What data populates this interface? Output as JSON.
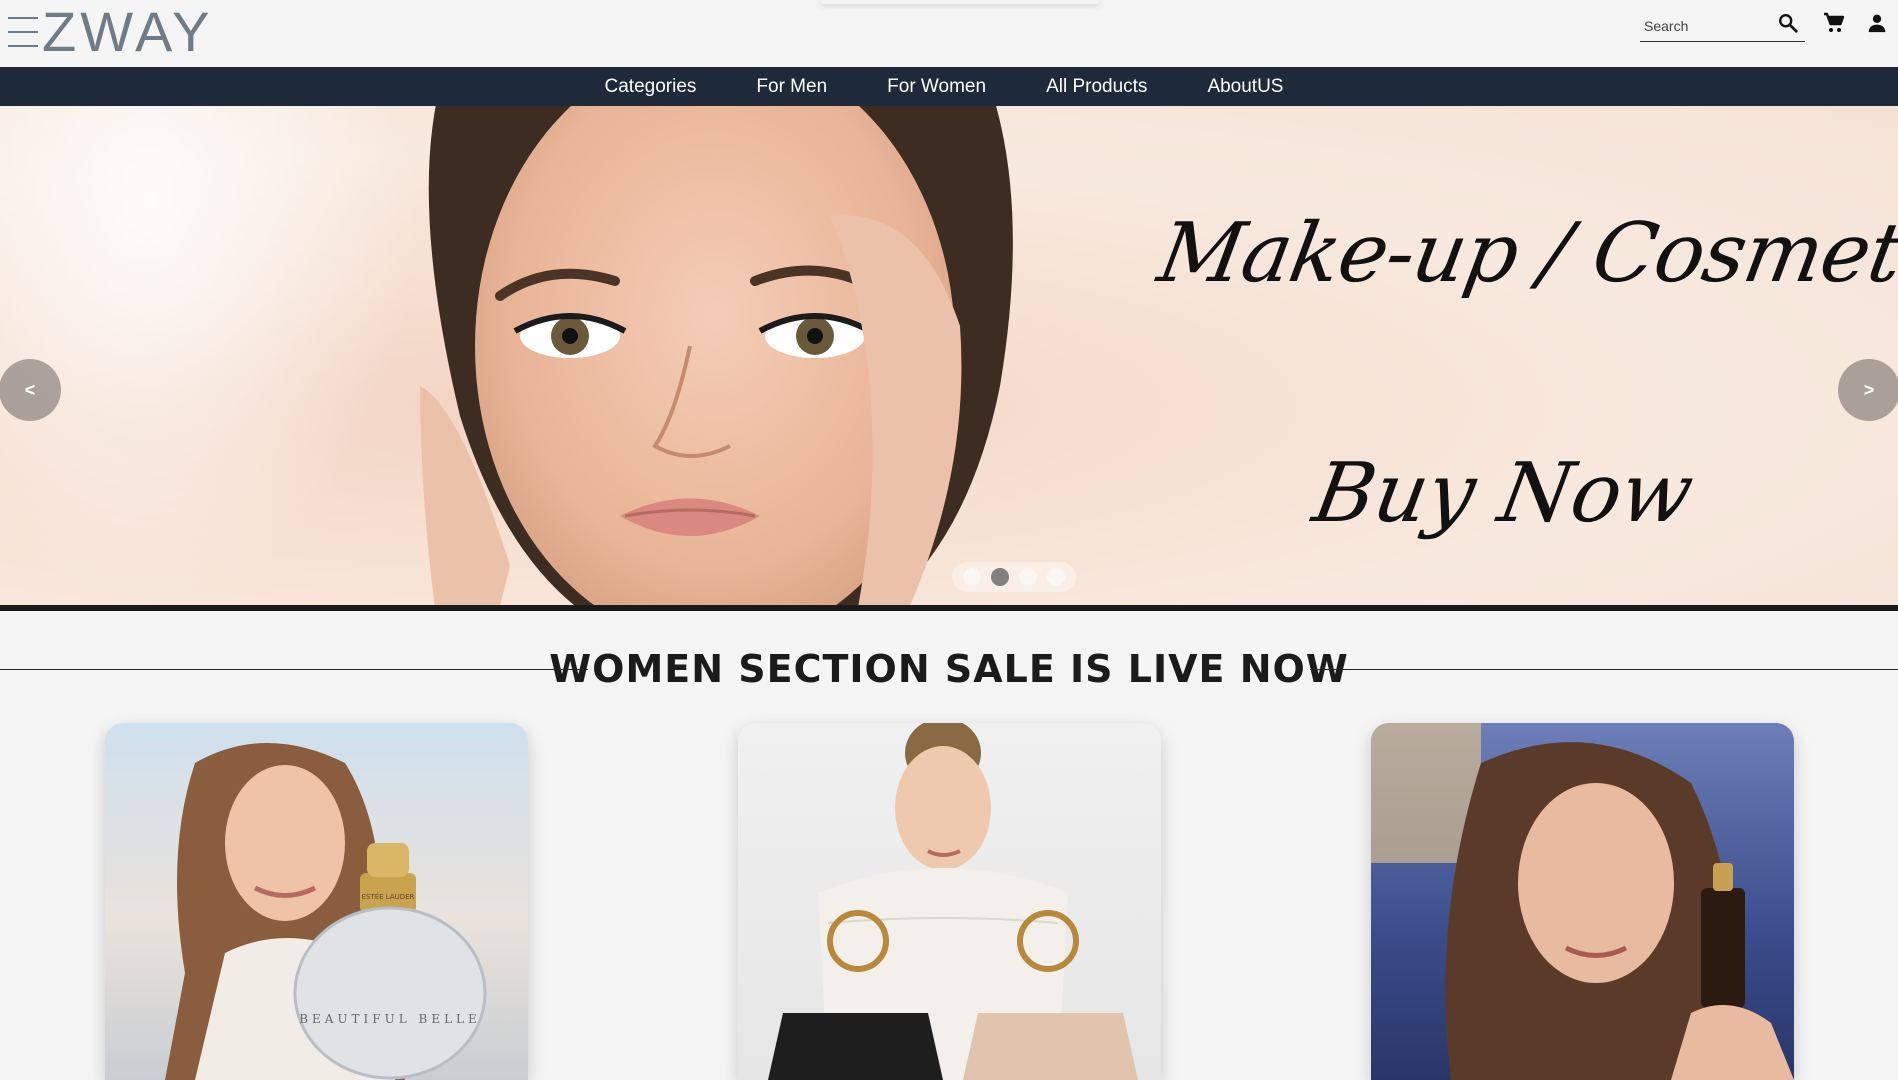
{
  "header": {
    "logo_text": "ZWAY",
    "search": {
      "placeholder": "Search"
    },
    "icons": [
      "search-icon",
      "cart-icon",
      "user-icon"
    ]
  },
  "nav": {
    "items": [
      {
        "label": "Categories"
      },
      {
        "label": "For Men"
      },
      {
        "label": "For Women"
      },
      {
        "label": "All Products"
      },
      {
        "label": "AboutUS"
      }
    ]
  },
  "hero": {
    "title": "Make-up / Cosmetics",
    "cta": "Buy Now",
    "prev_label": "<",
    "next_label": ">",
    "slide_count": 4,
    "active_slide": 2
  },
  "section": {
    "title": "WOMEN SECTION SALE IS LIVE NOW"
  },
  "cards": [
    {
      "name": "perfume-card",
      "bottle_label": "BEAUTIFUL BELLE",
      "cap_label": "ESTÉE LAUDER"
    },
    {
      "name": "handbags-card"
    },
    {
      "name": "serum-card"
    }
  ],
  "colors": {
    "nav_bg": "#1e2a3a",
    "page_bg": "#f5f5f5",
    "logo": "#6f7b86",
    "text": "#1b1b1b"
  }
}
